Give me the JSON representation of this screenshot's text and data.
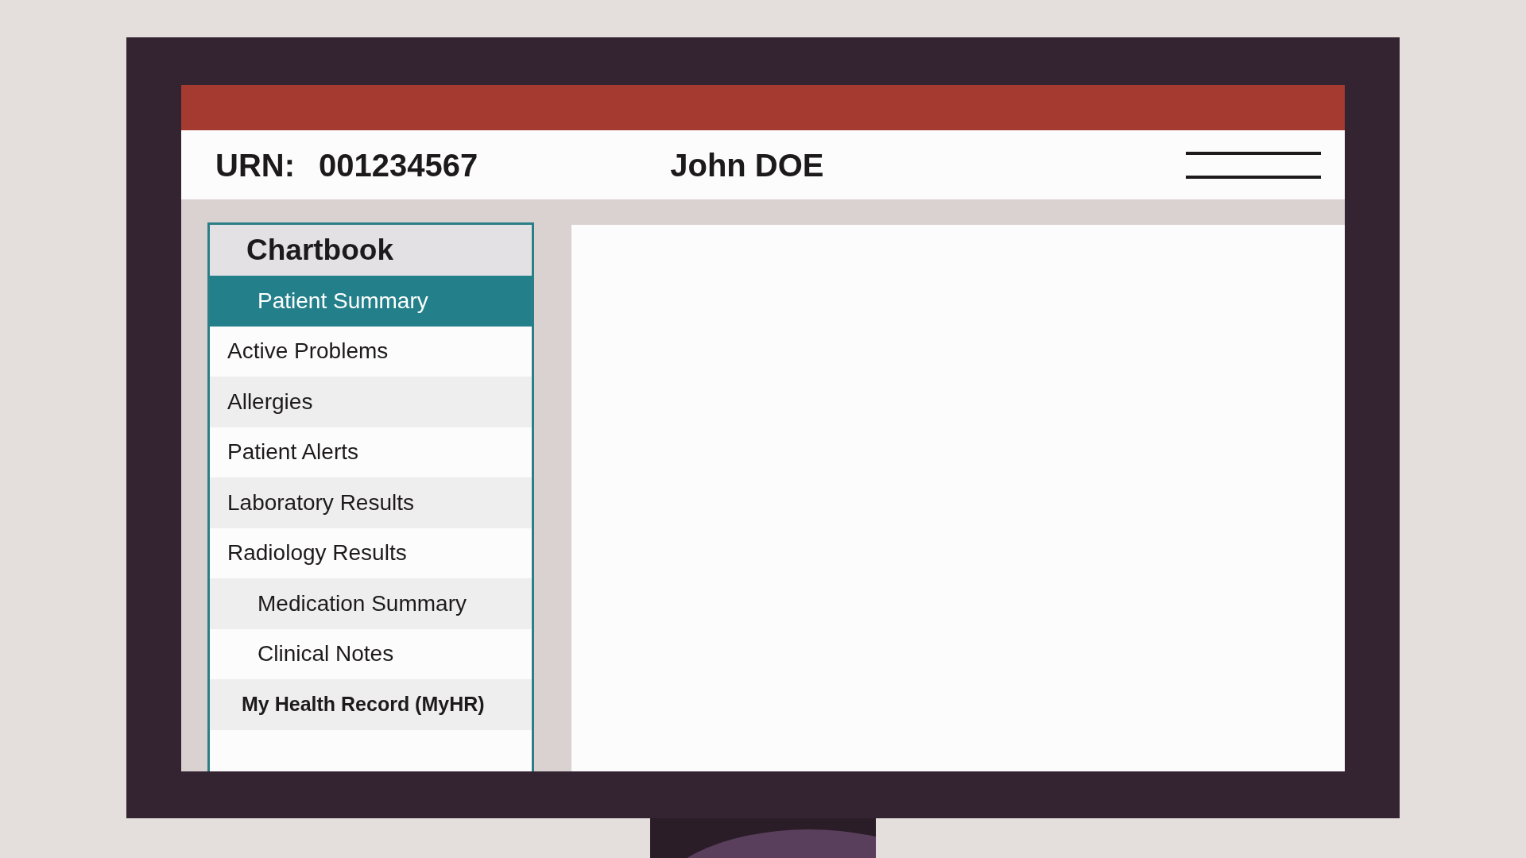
{
  "header": {
    "urn_label": "URN:",
    "urn": "001234567",
    "patient_name": "John DOE"
  },
  "sidebar": {
    "title": "Chartbook",
    "items": [
      {
        "label": "Patient Summary",
        "kind": "indented",
        "selected": true
      },
      {
        "label": "Active Problems",
        "kind": "flush",
        "selected": false
      },
      {
        "label": "Allergies",
        "kind": "flush",
        "selected": false
      },
      {
        "label": "Patient Alerts",
        "kind": "flush",
        "selected": false
      },
      {
        "label": "Laboratory Results",
        "kind": "flush",
        "selected": false
      },
      {
        "label": "Radiology Results",
        "kind": "flush",
        "selected": false
      },
      {
        "label": "Medication Summary",
        "kind": "indented",
        "selected": false
      },
      {
        "label": "Clinical Notes",
        "kind": "indented",
        "selected": false
      },
      {
        "label": "My Health Record (MyHR)",
        "kind": "strong",
        "selected": false
      }
    ]
  }
}
